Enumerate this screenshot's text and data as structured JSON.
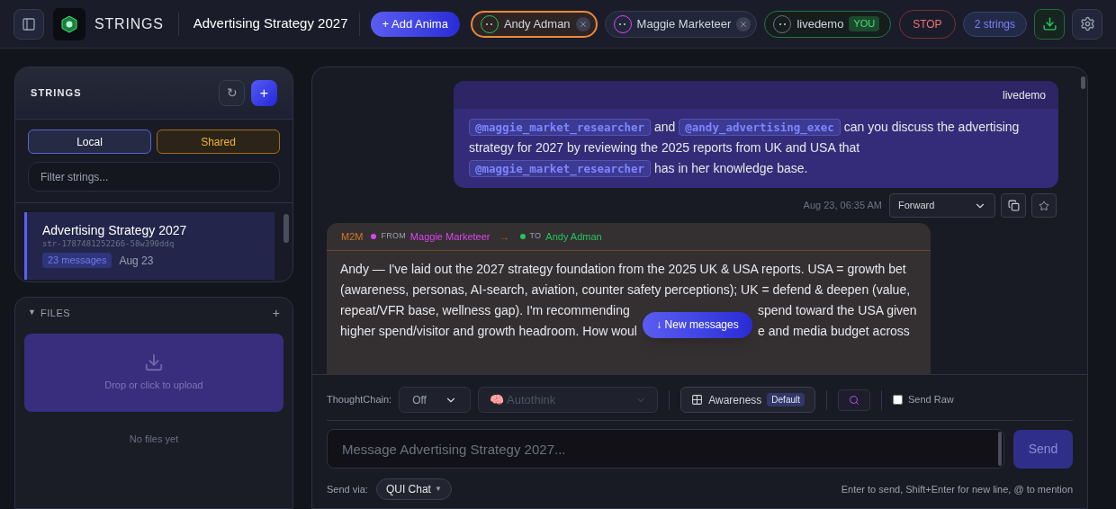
{
  "header": {
    "brand": "STRINGS",
    "title": "Advertising Strategy 2027",
    "add_button": "+ Add Anima",
    "participants": [
      {
        "name": "Andy Adman",
        "color": "#22c55e",
        "selected": true,
        "removable": true
      },
      {
        "name": "Maggie Marketeer",
        "color": "#d946ef",
        "selected": false,
        "removable": true
      },
      {
        "name": "livedemo",
        "color": "#64748b",
        "selected": false,
        "removable": false,
        "badge": "YOU"
      }
    ],
    "stop": "STOP",
    "count": "2 strings"
  },
  "sidebar": {
    "title": "STRINGS",
    "refresh": "↻",
    "add": "+",
    "tabs": [
      {
        "label": "Local",
        "selected": true
      },
      {
        "label": "Shared",
        "selected": false
      }
    ],
    "filter": {
      "placeholder": "Filter strings..."
    },
    "strings": [
      {
        "title": "Advertising Strategy 2027",
        "id": "str-1787481252266-58w390ddq",
        "count": "23 messages",
        "date": "Aug 23",
        "selected": true
      }
    ],
    "files": {
      "title": "FILES",
      "toggle": "▼",
      "expanded": true,
      "add": "+",
      "drop": "Drop or click to upload",
      "empty": "No files yet"
    }
  },
  "chat": {
    "messages": [
      {
        "kind": "user",
        "author": "livedemo",
        "segments": [
          {
            "kind": "mention",
            "text": "@maggie_market_researcher"
          },
          {
            "kind": "text",
            "text": " and "
          },
          {
            "kind": "mention",
            "text": "@andy_advertising_exec"
          },
          {
            "kind": "text",
            "text": " can you discuss the advertising strategy for 2027 by reviewing the 2025 reports from UK and USA that "
          },
          {
            "kind": "mention",
            "text": "@maggie_market_researcher"
          },
          {
            "kind": "text",
            "text": " has in her knowledge base."
          }
        ],
        "time": "Aug 23, 06:35 AM",
        "action": "Forward"
      },
      {
        "kind": "m2m",
        "tag": "M2M",
        "from": {
          "label": "FROM",
          "name": "Maggie Marketeer",
          "color": "#d946ef"
        },
        "arrow": "→",
        "to": {
          "label": "TO",
          "name": "Andy Adman",
          "color": "#22c55e"
        },
        "lines": [
          "Andy — I've laid out the 2027 strategy foundation from the 2025 UK & USA reports. USA = growth bet",
          "(awareness, personas, AI-search, aviation, counter safety perceptions); UK = defend & deepen (value,"
        ],
        "covered_lines": [
          {
            "before": "repeat/VFR base, wellness gap). I'm recommending",
            "after": "spend toward the USA given"
          },
          {
            "before": "higher spend/visitor and growth headroom. How woul",
            "after": "e and media budget across"
          }
        ]
      }
    ],
    "new_messages": "↓ New messages",
    "controls": {
      "thoughtchain_label": "ThoughtChain:",
      "thoughtchain": "Off",
      "autothink": "🧠 Autothink",
      "autothink_disabled": true,
      "awareness": "Awareness",
      "awareness_badge": "Default",
      "send_raw": "Send Raw",
      "send_raw_checked": false
    },
    "input": {
      "placeholder": "Message Advertising Strategy 2027..."
    },
    "send": "Send",
    "send_via_label": "Send via:",
    "send_via": "QUI Chat",
    "send_via_caret": "▼",
    "hint": "Enter to send, Shift+Enter for new line, @ to mention"
  }
}
